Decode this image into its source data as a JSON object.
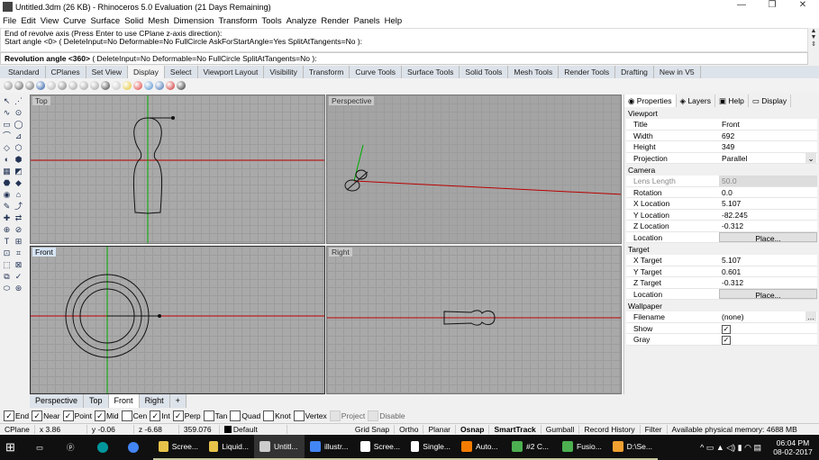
{
  "window": {
    "title": "Untitled.3dm (26 KB) - Rhinoceros 5.0 Evaluation (21 Days Remaining)",
    "minimize": "—",
    "restore": "❐",
    "close": "✕"
  },
  "menu": [
    "File",
    "Edit",
    "View",
    "Curve",
    "Surface",
    "Solid",
    "Mesh",
    "Dimension",
    "Transform",
    "Tools",
    "Analyze",
    "Render",
    "Panels",
    "Help"
  ],
  "command": {
    "history": [
      "End of revolve axis (Press Enter to use CPlane z-axis direction):",
      "Start angle <0> ( DeleteInput=No  Deformable=No  FullCircle  AskForStartAngle=Yes  SplitAtTangents=No ):"
    ],
    "prompt": "Revolution angle <360>",
    "options": " ( DeleteInput=No  Deformable=No  FullCircle  SplitAtTangents=No ):"
  },
  "toolbar_tabs": [
    "Standard",
    "CPlanes",
    "Set View",
    "Display",
    "Select",
    "Viewport Layout",
    "Visibility",
    "Transform",
    "Curve Tools",
    "Surface Tools",
    "Solid Tools",
    "Mesh Tools",
    "Render Tools",
    "Drafting",
    "New in V5"
  ],
  "active_tab": "Display",
  "viewports": {
    "top": "Top",
    "perspective": "Perspective",
    "front": "Front",
    "right": "Right"
  },
  "active_viewport": "Front",
  "viewport_tabs": [
    "Perspective",
    "Top",
    "Front",
    "Right",
    "+"
  ],
  "osnap": [
    {
      "label": "End",
      "checked": true
    },
    {
      "label": "Near",
      "checked": true
    },
    {
      "label": "Point",
      "checked": true
    },
    {
      "label": "Mid",
      "checked": true
    },
    {
      "label": "Cen",
      "checked": false
    },
    {
      "label": "Int",
      "checked": true
    },
    {
      "label": "Perp",
      "checked": true
    },
    {
      "label": "Tan",
      "checked": false
    },
    {
      "label": "Quad",
      "checked": false
    },
    {
      "label": "Knot",
      "checked": false
    },
    {
      "label": "Vertex",
      "checked": false
    },
    {
      "label": "Project",
      "checked": false,
      "disabled": true
    },
    {
      "label": "Disable",
      "checked": false,
      "disabled": true
    }
  ],
  "status": {
    "cplane": "CPlane",
    "x": "x 3.86",
    "y": "y -0.06",
    "z": "z -6.68",
    "angle": "359.076",
    "layer": "Default",
    "toggles": [
      "Grid Snap",
      "Ortho",
      "Planar",
      "Osnap",
      "SmartTrack",
      "Gumball",
      "Record History",
      "Filter"
    ],
    "memory": "Available physical memory: 4688 MB"
  },
  "panel": {
    "tabs": [
      "Properties",
      "Layers",
      "Help",
      "Display"
    ],
    "sections": [
      {
        "name": "Viewport",
        "rows": [
          {
            "k": "Title",
            "v": "Front"
          },
          {
            "k": "Width",
            "v": "692"
          },
          {
            "k": "Height",
            "v": "349"
          },
          {
            "k": "Projection",
            "v": "Parallel",
            "dropdown": true
          }
        ]
      },
      {
        "name": "Camera",
        "rows": [
          {
            "k": "Lens Length",
            "v": "50.0",
            "disabled": true
          },
          {
            "k": "Rotation",
            "v": "0.0"
          },
          {
            "k": "X Location",
            "v": "5.107"
          },
          {
            "k": "Y Location",
            "v": "-82.245"
          },
          {
            "k": "Z Location",
            "v": "-0.312"
          },
          {
            "k": "Location",
            "v": "Place...",
            "button": true
          }
        ]
      },
      {
        "name": "Target",
        "rows": [
          {
            "k": "X Target",
            "v": "5.107"
          },
          {
            "k": "Y Target",
            "v": "0.601"
          },
          {
            "k": "Z Target",
            "v": "-0.312"
          },
          {
            "k": "Location",
            "v": "Place...",
            "button": true
          }
        ]
      },
      {
        "name": "Wallpaper",
        "rows": [
          {
            "k": "Filename",
            "v": "(none)",
            "browse": true
          },
          {
            "k": "Show",
            "v": "",
            "check": true
          },
          {
            "k": "Gray",
            "v": "",
            "check": true
          }
        ]
      }
    ]
  },
  "taskbar": {
    "items": [
      {
        "label": "Scree...",
        "color": "#e8c34a"
      },
      {
        "label": "Liquid...",
        "color": "#e8c34a"
      },
      {
        "label": "Untitl...",
        "color": "#ccc"
      },
      {
        "label": "illustr...",
        "color": "#4285f4"
      },
      {
        "label": "Scree...",
        "color": "#fff"
      },
      {
        "label": "Single...",
        "color": "#fff"
      },
      {
        "label": "Auto...",
        "color": "#f57c00"
      },
      {
        "label": "#2 C...",
        "color": "#4caf50"
      },
      {
        "label": "Fusio...",
        "color": "#4caf50"
      },
      {
        "label": "D:\\Se...",
        "color": "#f0a030"
      }
    ],
    "time": "06:04 PM",
    "date": "08-02-2017"
  }
}
